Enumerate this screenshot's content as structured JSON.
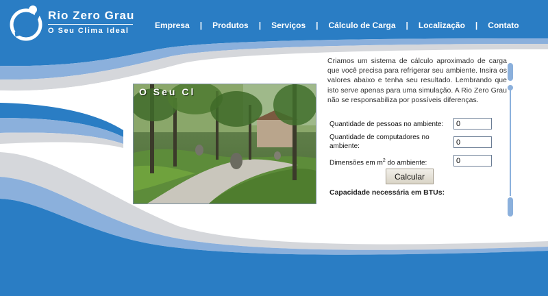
{
  "brand": {
    "name": "Rio Zero Grau",
    "slogan": "O Seu Clima Ideal"
  },
  "nav": {
    "items": [
      "Empresa",
      "Produtos",
      "Serviços",
      "Cálculo de Carga",
      "Localização",
      "Contato"
    ],
    "separator": "|"
  },
  "photo": {
    "caption": "O Seu Cl"
  },
  "intro": "Criamos um sistema de cálculo aproximado de carga que você precisa para refrigerar seu ambiente. Insira os valores abaixo e tenha seu resultado. Lembrando que isto serve apenas para uma simulação. A Rio Zero Grau não se responsabiliza por possíveis diferenças.",
  "form": {
    "people": {
      "label": "Quantidade de pessoas no ambiente:",
      "value": "0"
    },
    "computers": {
      "label": "Quantidade de computadores no ambiente:",
      "value": "0"
    },
    "area": {
      "label_prefix": "Dimensões em m",
      "label_sup": "2",
      "label_suffix": " do ambiente:",
      "value": "0"
    },
    "button_label": "Calcular",
    "result_label": "Capacidade necessária em BTUs:"
  },
  "colors": {
    "primary_blue": "#2a7dc4",
    "light_blue": "#8bb0dc",
    "gray_band": "#d5d7db",
    "white": "#ffffff"
  }
}
